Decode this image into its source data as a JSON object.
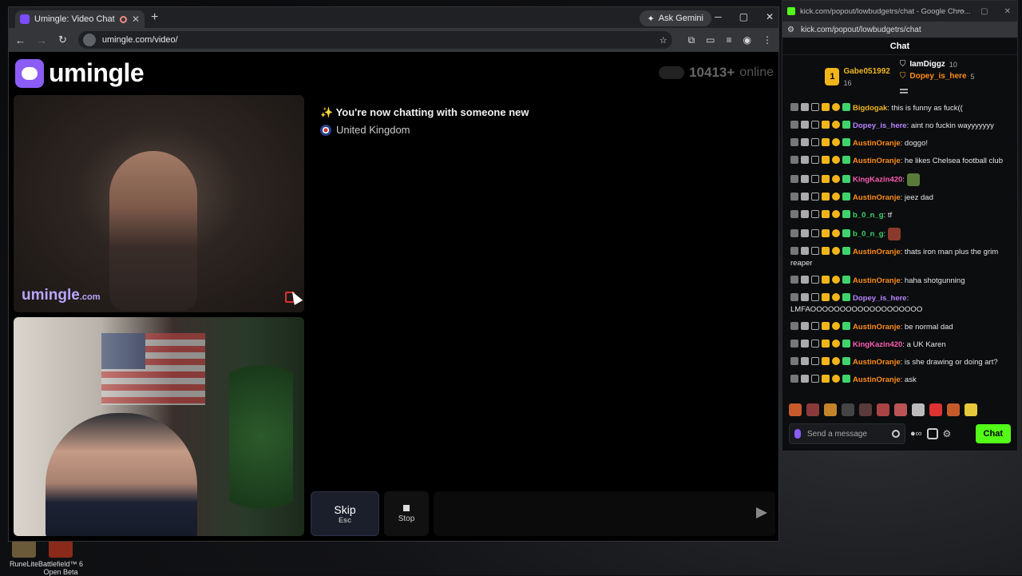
{
  "browser_left": {
    "tab_title": "Umingle: Video Chat with S",
    "new_tab": "+",
    "ask_gemini": "Ask Gemini",
    "url": "umingle.com/video/",
    "window_controls": [
      "─",
      "▢",
      "✕"
    ]
  },
  "site": {
    "logo_text": "umingle",
    "online_count": "10413+",
    "online_label": "online",
    "watermark": "umingle",
    "watermark_tld": ".com",
    "system_msg": "✨ You're now chatting with someone new",
    "country": "United Kingdom",
    "skip_label": "Skip",
    "skip_hint": "Esc",
    "stop_label": "Stop"
  },
  "browser_right": {
    "title": "kick.com/popout/lowbudgetrs/chat - Google Chro...",
    "url": "kick.com/popout/lowbudgetrs/chat",
    "window_controls": [
      "─",
      "▢",
      "✕"
    ]
  },
  "kick": {
    "header": "Chat",
    "top_gifter": {
      "rank": "1",
      "name": "Gabe051992",
      "count": "16"
    },
    "gifters": [
      {
        "name": "IamDiggz",
        "count": "10",
        "color": "#ffffff"
      },
      {
        "name": "Dopey_is_here",
        "count": "5",
        "color": "#ff8c1a"
      }
    ],
    "messages": [
      {
        "user": "Bigdogak",
        "color": "#f1b51c",
        "text": ": this is funny as fuck(("
      },
      {
        "user": "Dopey_is_here",
        "color": "#b784ff",
        "text": ": aint no fuckin wayyyyyyy"
      },
      {
        "user": "AustinOranje",
        "color": "#ff8c1a",
        "text": ": doggo!"
      },
      {
        "user": "AustinOranje",
        "color": "#ff8c1a",
        "text": ": he likes Chelsea football club"
      },
      {
        "user": "KingKazin420",
        "color": "#ff5db1",
        "text": ":"
      },
      {
        "user": "AustinOranje",
        "color": "#ff8c1a",
        "text": ": jeez dad"
      },
      {
        "user": "b_0_n_g",
        "color": "#3fd46b",
        "text": ": tf"
      },
      {
        "user": "b_0_n_g",
        "color": "#3fd46b",
        "text": ":"
      },
      {
        "user": "AustinOranje",
        "color": "#ff8c1a",
        "text": ": thats iron man plus the grim reaper"
      },
      {
        "user": "AustinOranje",
        "color": "#ff8c1a",
        "text": ": haha shotgunning"
      },
      {
        "user": "Dopey_is_here",
        "color": "#b784ff",
        "text": ": LMFAOOOOOOOOOOOOOOOOOOO"
      },
      {
        "user": "AustinOranje",
        "color": "#ff8c1a",
        "text": ": be normal dad"
      },
      {
        "user": "KingKazin420",
        "color": "#ff5db1",
        "text": ": a UK Karen"
      },
      {
        "user": "AustinOranje",
        "color": "#ff8c1a",
        "text": ": is she drawing or doing art?"
      },
      {
        "user": "AustinOranje",
        "color": "#ff8c1a",
        "text": ": ask"
      }
    ],
    "input_placeholder": "Send a message",
    "chat_button": "Chat"
  },
  "desktop": {
    "icons": [
      "RuneLite",
      "Battlefield™ 6 Open Beta"
    ]
  },
  "colors": {
    "umingle_purple": "#8b5cf6",
    "kick_green": "#53fc18"
  }
}
